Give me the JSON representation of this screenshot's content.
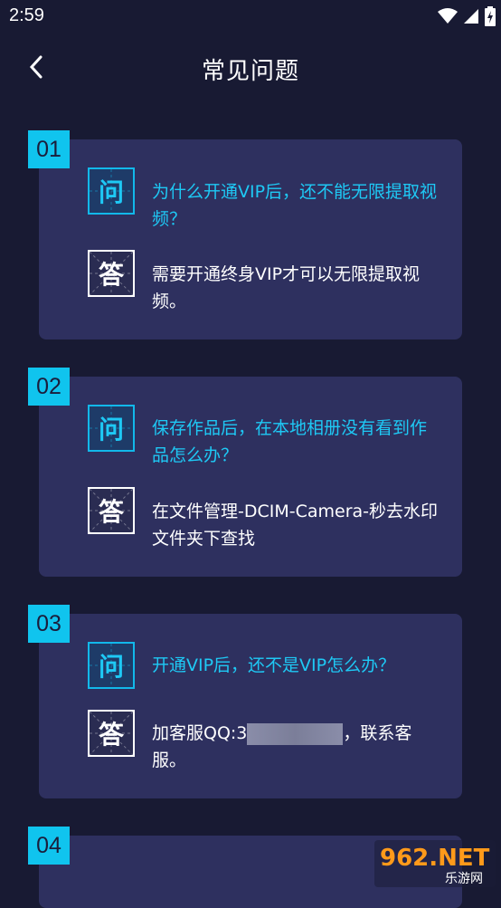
{
  "status": {
    "time": "2:59"
  },
  "header": {
    "title": "常见问题"
  },
  "labels": {
    "question_char": "问",
    "answer_char": "答"
  },
  "faq": [
    {
      "number": "01",
      "question": "为什么开通VIP后，还不能无限提取视频？",
      "answer": "需要开通终身VIP才可以无限提取视频。"
    },
    {
      "number": "02",
      "question": "保存作品后，在本地相册没有看到作品怎么办？",
      "answer": " 在文件管理-DCIM-Camera-秒去水印文件夹下查找"
    },
    {
      "number": "03",
      "question": "开通VIP后，还不是VIP怎么办？",
      "answer_prefix": " 加客服QQ:3",
      "answer_suffix": "，联系客服。"
    },
    {
      "number": "04"
    }
  ],
  "watermark": {
    "brand": "962.NET",
    "subtitle": "乐游网"
  },
  "colors": {
    "background": "#181a33",
    "card": "#2e305f",
    "accent": "#10c4ee"
  }
}
